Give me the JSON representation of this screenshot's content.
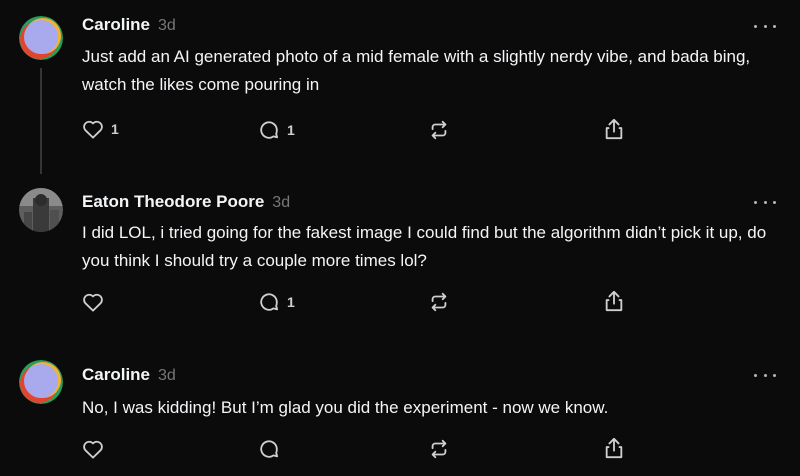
{
  "posts": [
    {
      "username": "Caroline",
      "time": "3d",
      "text": "Just add an AI generated photo of a mid female with a slightly nerdy vibe, and bada bing, watch the likes come pouring in",
      "likes": "1",
      "replies": "1"
    },
    {
      "username": "Eaton Theodore Poore",
      "time": "3d",
      "text": "I did LOL, i tried going for the fakest image I could find but the algorithm didn’t pick it up, do you think I should try a couple more times lol?",
      "likes": "",
      "replies": "1"
    },
    {
      "username": "Caroline",
      "time": "3d",
      "text": "No, I was kidding! But I’m glad you did the experiment - now we know.",
      "likes": "",
      "replies": ""
    }
  ],
  "icons": {
    "like": "heart-icon",
    "reply": "comment-icon",
    "repost": "repost-icon",
    "share": "share-icon",
    "more": "more-icon"
  },
  "colors": {
    "background": "#0b0b0c",
    "text": "#f3f5f7",
    "secondary": "#777777",
    "thread_line": "#333638"
  }
}
